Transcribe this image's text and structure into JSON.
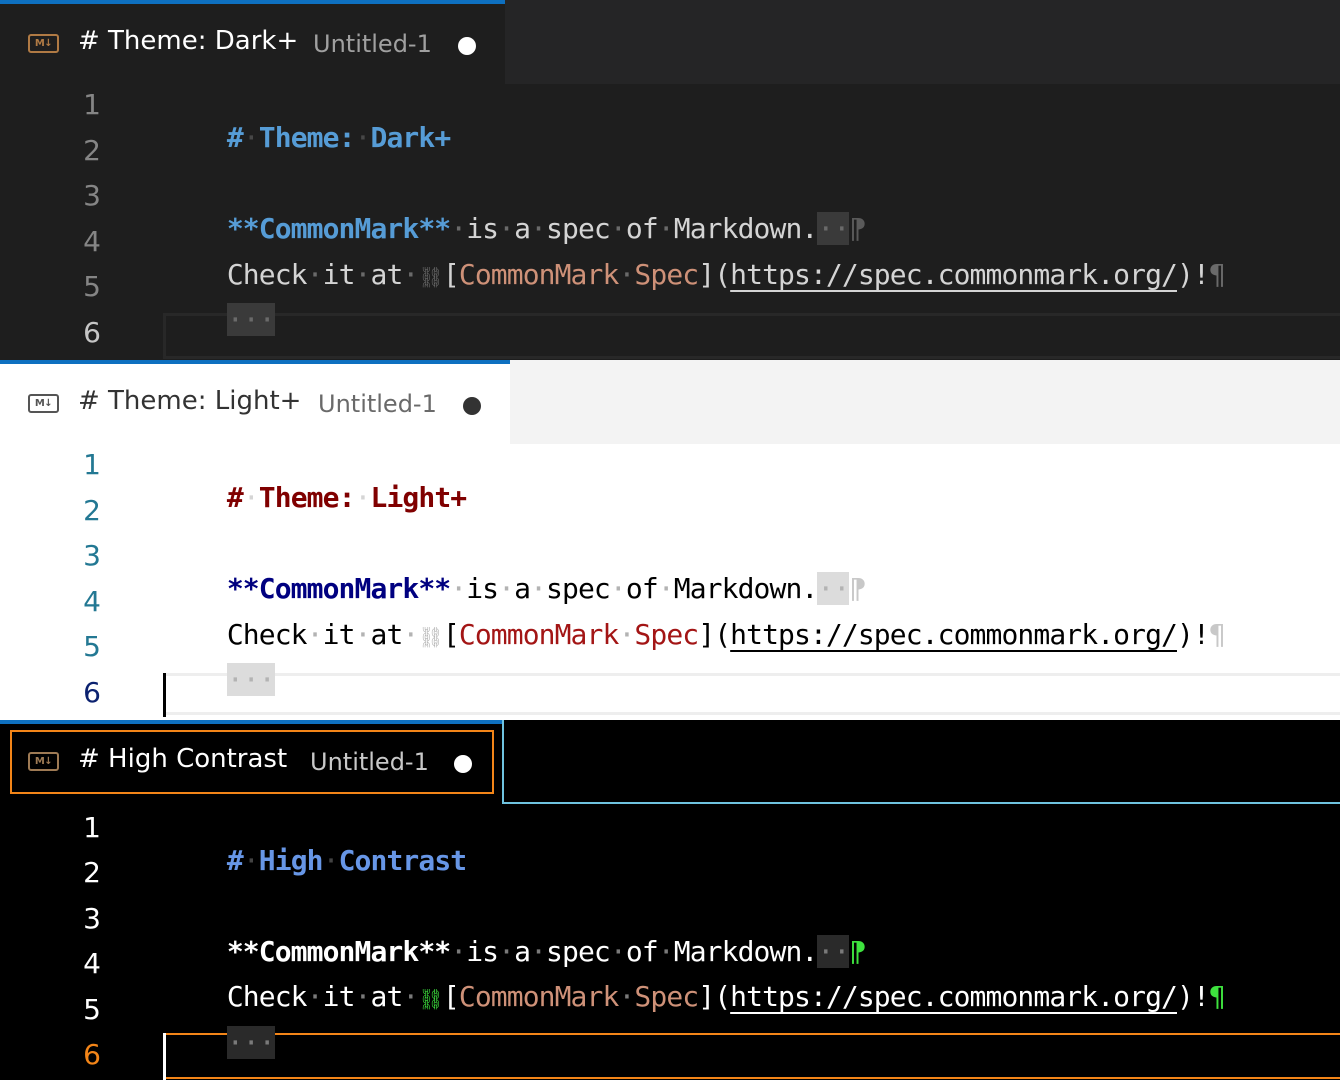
{
  "panels": [
    {
      "id": "dark",
      "tab_icon": "M↓",
      "tab_title": "# Theme: Dark+",
      "tab_file": "Untitled-1",
      "line_numbers": [
        "1",
        "2",
        "3",
        "4",
        "5",
        "6"
      ],
      "heading_hash": "#",
      "heading_text": "Theme:",
      "heading_text2": "Dark+",
      "bold_text": "**CommonMark**",
      "line3_rest": " is a spec of Markdown.",
      "line4_pre": "Check it at ",
      "link_open": "[",
      "link_text": "CommonMark Spec",
      "link_close_paren": "](",
      "link_url": "https://spec.commonmark.org/",
      "link_end": ")!",
      "pilcrow": "¶",
      "pilcrow_soft": "⁋",
      "ellipsis": "···",
      "colors": {
        "bg": "#1e1e1e",
        "heading": "#569cd6",
        "bold": "#569cd6",
        "text": "#d4d4d4",
        "link_text": "#ce9178",
        "accent": "#0e70c0"
      }
    },
    {
      "id": "light",
      "tab_icon": "M↓",
      "tab_title": "# Theme: Light+",
      "tab_file": "Untitled-1",
      "line_numbers": [
        "1",
        "2",
        "3",
        "4",
        "5",
        "6"
      ],
      "heading_hash": "#",
      "heading_text": "Theme:",
      "heading_text2": "Light+",
      "bold_text": "**CommonMark**",
      "line3_rest": " is a spec of Markdown.",
      "line4_pre": "Check it at ",
      "link_open": "[",
      "link_text": "CommonMark Spec",
      "link_close_paren": "](",
      "link_url": "https://spec.commonmark.org/",
      "link_end": ")!",
      "pilcrow": "¶",
      "pilcrow_soft": "⁋",
      "ellipsis": "···",
      "colors": {
        "bg": "#ffffff",
        "heading": "#800000",
        "bold": "#000080",
        "text": "#000000",
        "link_text": "#a31515",
        "accent": "#0e70c0"
      }
    },
    {
      "id": "high-contrast",
      "tab_icon": "M↓",
      "tab_title": "# High Contrast",
      "tab_file": "Untitled-1",
      "line_numbers": [
        "1",
        "2",
        "3",
        "4",
        "5",
        "6"
      ],
      "heading_hash": "#",
      "heading_text": "High",
      "heading_text2": "Contrast",
      "bold_text": "**CommonMark**",
      "line3_rest": " is a spec of Markdown.",
      "line4_pre": "Check it at ",
      "link_open": "[",
      "link_text": "CommonMark Spec",
      "link_close_paren": "](",
      "link_url": "https://spec.commonmark.org/",
      "link_end": ")!",
      "pilcrow": "¶",
      "pilcrow_soft": "⁋",
      "ellipsis": "···",
      "colors": {
        "bg": "#000000",
        "heading": "#6796e6",
        "bold": "#ffffff",
        "text": "#ffffff",
        "link_text": "#ce9178",
        "accent": "#f38518"
      }
    }
  ]
}
